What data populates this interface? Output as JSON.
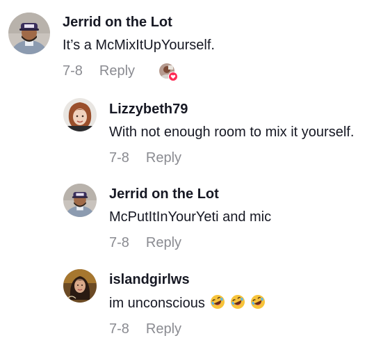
{
  "comments": [
    {
      "username": "Jerrid on the Lot",
      "text": "It’s a McMixItUpYourself.",
      "date": "7-8",
      "reply_label": "Reply",
      "avatar_icon": "avatar-jerrid-icon",
      "liked_by_creator": true
    },
    {
      "username": "Lizzybeth79",
      "text": "With not enough room to mix it yourself.",
      "date": "7-8",
      "reply_label": "Reply",
      "avatar_icon": "avatar-lizzybeth-icon"
    },
    {
      "username": "Jerrid on the Lot",
      "text": "McPutItInYourYeti and mic",
      "date": "7-8",
      "reply_label": "Reply",
      "avatar_icon": "avatar-jerrid-icon"
    },
    {
      "username": "islandgirlws",
      "text": "im unconscious",
      "emoji": [
        "rolling-on-floor-laughing-emoji",
        "rolling-on-floor-laughing-emoji",
        "rolling-on-floor-laughing-emoji"
      ],
      "date": "7-8",
      "reply_label": "Reply",
      "avatar_icon": "avatar-islandgirl-icon"
    }
  ],
  "colors": {
    "text": "#161823",
    "meta": "#8a8b91",
    "heart_badge": "#fe2c55"
  }
}
